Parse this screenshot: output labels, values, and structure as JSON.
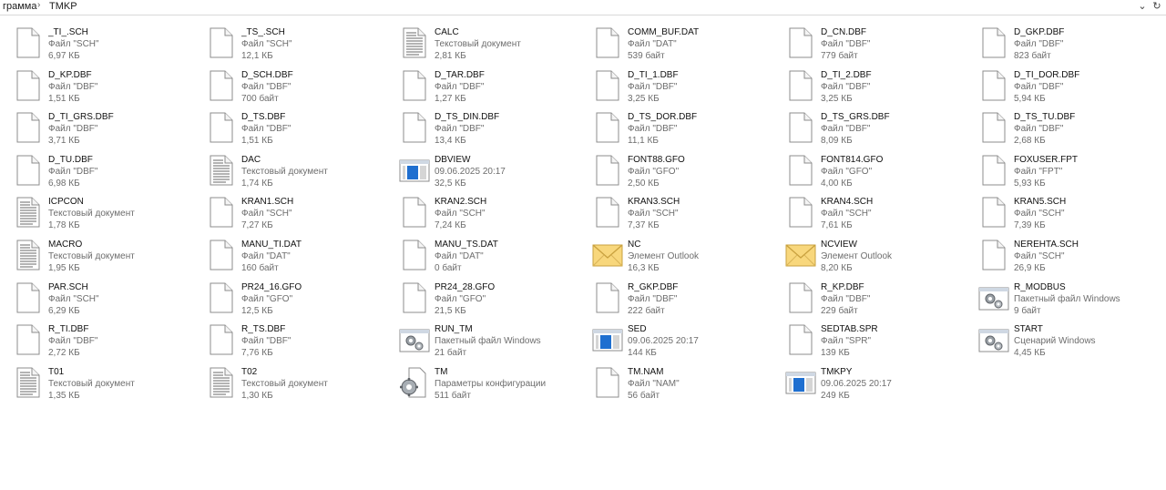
{
  "breadcrumb": {
    "parent": "грамма",
    "separator": "›",
    "current": "TMKP"
  },
  "address_bar": {
    "dropdown_icon": "chevron-down-icon",
    "refresh_icon": "refresh-icon"
  },
  "files": [
    {
      "name": "_TI_.SCH",
      "type": "Файл \"SCH\"",
      "size": "6,97 КБ",
      "icon": "blank"
    },
    {
      "name": "_TS_.SCH",
      "type": "Файл \"SCH\"",
      "size": "12,1 КБ",
      "icon": "blank"
    },
    {
      "name": "CALC",
      "type": "Текстовый документ",
      "size": "2,81 КБ",
      "icon": "text"
    },
    {
      "name": "COMM_BUF.DAT",
      "type": "Файл \"DAT\"",
      "size": "539 байт",
      "icon": "blank"
    },
    {
      "name": "D_CN.DBF",
      "type": "Файл \"DBF\"",
      "size": "779 байт",
      "icon": "blank"
    },
    {
      "name": "D_GKP.DBF",
      "type": "Файл \"DBF\"",
      "size": "823 байт",
      "icon": "blank"
    },
    {
      "name": "D_KP.DBF",
      "type": "Файл \"DBF\"",
      "size": "1,51 КБ",
      "icon": "blank"
    },
    {
      "name": "D_SCH.DBF",
      "type": "Файл \"DBF\"",
      "size": "700 байт",
      "icon": "blank"
    },
    {
      "name": "D_TAR.DBF",
      "type": "Файл \"DBF\"",
      "size": "1,27 КБ",
      "icon": "blank"
    },
    {
      "name": "D_TI_1.DBF",
      "type": "Файл \"DBF\"",
      "size": "3,25 КБ",
      "icon": "blank"
    },
    {
      "name": "D_TI_2.DBF",
      "type": "Файл \"DBF\"",
      "size": "3,25 КБ",
      "icon": "blank"
    },
    {
      "name": "D_TI_DOR.DBF",
      "type": "Файл \"DBF\"",
      "size": "5,94 КБ",
      "icon": "blank"
    },
    {
      "name": "D_TI_GRS.DBF",
      "type": "Файл \"DBF\"",
      "size": "3,71 КБ",
      "icon": "blank"
    },
    {
      "name": "D_TS.DBF",
      "type": "Файл \"DBF\"",
      "size": "1,51 КБ",
      "icon": "blank"
    },
    {
      "name": "D_TS_DIN.DBF",
      "type": "Файл \"DBF\"",
      "size": "13,4 КБ",
      "icon": "blank"
    },
    {
      "name": "D_TS_DOR.DBF",
      "type": "Файл \"DBF\"",
      "size": "11,1 КБ",
      "icon": "blank"
    },
    {
      "name": "D_TS_GRS.DBF",
      "type": "Файл \"DBF\"",
      "size": "8,09 КБ",
      "icon": "blank"
    },
    {
      "name": "D_TS_TU.DBF",
      "type": "Файл \"DBF\"",
      "size": "2,68 КБ",
      "icon": "blank"
    },
    {
      "name": "D_TU.DBF",
      "type": "Файл \"DBF\"",
      "size": "6,98 КБ",
      "icon": "blank"
    },
    {
      "name": "DAC",
      "type": "Текстовый документ",
      "size": "1,74 КБ",
      "icon": "text"
    },
    {
      "name": "DBVIEW",
      "type": "09.06.2025 20:17",
      "size": "32,5 КБ",
      "icon": "exe"
    },
    {
      "name": "FONT88.GFO",
      "type": "Файл \"GFO\"",
      "size": "2,50 КБ",
      "icon": "blank"
    },
    {
      "name": "FONT814.GFO",
      "type": "Файл \"GFO\"",
      "size": "4,00 КБ",
      "icon": "blank"
    },
    {
      "name": "FOXUSER.FPT",
      "type": "Файл \"FPT\"",
      "size": "5,93 КБ",
      "icon": "blank"
    },
    {
      "name": "ICPCON",
      "type": "Текстовый документ",
      "size": "1,78 КБ",
      "icon": "text"
    },
    {
      "name": "KRAN1.SCH",
      "type": "Файл \"SCH\"",
      "size": "7,27 КБ",
      "icon": "blank"
    },
    {
      "name": "KRAN2.SCH",
      "type": "Файл \"SCH\"",
      "size": "7,24 КБ",
      "icon": "blank"
    },
    {
      "name": "KRAN3.SCH",
      "type": "Файл \"SCH\"",
      "size": "7,37 КБ",
      "icon": "blank"
    },
    {
      "name": "KRAN4.SCH",
      "type": "Файл \"SCH\"",
      "size": "7,61 КБ",
      "icon": "blank"
    },
    {
      "name": "KRAN5.SCH",
      "type": "Файл \"SCH\"",
      "size": "7,39 КБ",
      "icon": "blank"
    },
    {
      "name": "MACRO",
      "type": "Текстовый документ",
      "size": "1,95 КБ",
      "icon": "text"
    },
    {
      "name": "MANU_TI.DAT",
      "type": "Файл \"DAT\"",
      "size": "160 байт",
      "icon": "blank"
    },
    {
      "name": "MANU_TS.DAT",
      "type": "Файл \"DAT\"",
      "size": "0 байт",
      "icon": "blank"
    },
    {
      "name": "NC",
      "type": "Элемент Outlook",
      "size": "16,3 КБ",
      "icon": "mail"
    },
    {
      "name": "NCVIEW",
      "type": "Элемент Outlook",
      "size": "8,20 КБ",
      "icon": "mail"
    },
    {
      "name": "NEREHTA.SCH",
      "type": "Файл \"SCH\"",
      "size": "26,9 КБ",
      "icon": "blank"
    },
    {
      "name": "PAR.SCH",
      "type": "Файл \"SCH\"",
      "size": "6,29 КБ",
      "icon": "blank"
    },
    {
      "name": "PR24_16.GFO",
      "type": "Файл \"GFO\"",
      "size": "12,5 КБ",
      "icon": "blank"
    },
    {
      "name": "PR24_28.GFO",
      "type": "Файл \"GFO\"",
      "size": "21,5 КБ",
      "icon": "blank"
    },
    {
      "name": "R_GKP.DBF",
      "type": "Файл \"DBF\"",
      "size": "222 байт",
      "icon": "blank"
    },
    {
      "name": "R_KP.DBF",
      "type": "Файл \"DBF\"",
      "size": "229 байт",
      "icon": "blank"
    },
    {
      "name": "R_MODBUS",
      "type": "Пакетный файл Windows",
      "size": "9 байт",
      "icon": "bat"
    },
    {
      "name": "R_TI.DBF",
      "type": "Файл \"DBF\"",
      "size": "2,72 КБ",
      "icon": "blank"
    },
    {
      "name": "R_TS.DBF",
      "type": "Файл \"DBF\"",
      "size": "7,76 КБ",
      "icon": "blank"
    },
    {
      "name": "RUN_TM",
      "type": "Пакетный файл Windows",
      "size": "21 байт",
      "icon": "bat"
    },
    {
      "name": "SED",
      "type": "09.06.2025 20:17",
      "size": "144 КБ",
      "icon": "exe"
    },
    {
      "name": "SEDTAB.SPR",
      "type": "Файл \"SPR\"",
      "size": "139 КБ",
      "icon": "blank"
    },
    {
      "name": "START",
      "type": "Сценарий Windows",
      "size": "4,45 КБ",
      "icon": "bat"
    },
    {
      "name": "T01",
      "type": "Текстовый документ",
      "size": "1,35 КБ",
      "icon": "text"
    },
    {
      "name": "T02",
      "type": "Текстовый документ",
      "size": "1,30 КБ",
      "icon": "text"
    },
    {
      "name": "TM",
      "type": "Параметры конфигурации",
      "size": "511 байт",
      "icon": "cfg"
    },
    {
      "name": "TM.NAM",
      "type": "Файл \"NAM\"",
      "size": "56 байт",
      "icon": "blank"
    },
    {
      "name": "TMKPY",
      "type": "09.06.2025 20:17",
      "size": "249 КБ",
      "icon": "exe"
    }
  ]
}
